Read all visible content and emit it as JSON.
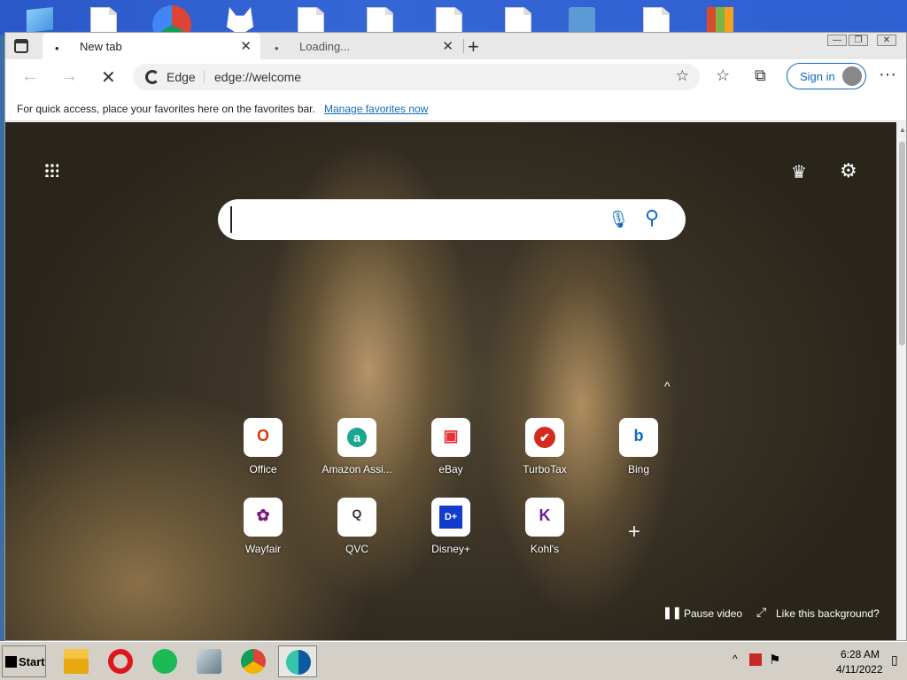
{
  "browser": {
    "tabs": [
      {
        "label": "New tab",
        "dot": "•",
        "close": "✕"
      },
      {
        "label": "Loading...",
        "dot": "•",
        "close": "✕"
      }
    ],
    "new_tab": "+",
    "window_buttons": [
      "—",
      "❐",
      "✕"
    ],
    "address": {
      "brand": "Edge",
      "url": "edge://welcome"
    },
    "sign_in_label": "Sign in",
    "more_label": "···",
    "favorites_bar": {
      "message": "For quick access, place your favorites here on the favorites bar.",
      "link": "Manage favorites now"
    }
  },
  "newtab": {
    "search": {
      "value": "",
      "placeholder": ""
    },
    "quick_links": [
      {
        "label": "Office",
        "glyph": "O",
        "color": "#d83b01"
      },
      {
        "label": "Amazon Assi...",
        "glyph": "a",
        "color": "#1aa68f"
      },
      {
        "label": "eBay",
        "glyph": "▣",
        "color": "#e53238"
      },
      {
        "label": "TurboTax",
        "glyph": "✔",
        "color": "#d52b1e"
      },
      {
        "label": "Bing",
        "glyph": "b",
        "color": "#0f6cbd"
      },
      {
        "label": "Wayfair",
        "glyph": "✿",
        "color": "#7f187f"
      },
      {
        "label": "QVC",
        "glyph": "Q",
        "color": "#333333"
      },
      {
        "label": "Disney+",
        "glyph": "D+",
        "color": "#113ccf"
      },
      {
        "label": "Kohl's",
        "glyph": "K",
        "color": "#6a1b9a"
      }
    ],
    "pause_video": "Pause video",
    "like_background": "Like this background?"
  },
  "taskbar": {
    "start_label": "Start",
    "clock": {
      "time": "6:28 AM",
      "date": "4/11/2022"
    }
  },
  "icons": {
    "back": "←",
    "forward": "→",
    "stop": "✕",
    "favorites": "☆",
    "collections": "⧉",
    "add_favorite": "☆",
    "mic": "🎙",
    "search": "⚲",
    "settings": "⚙",
    "rewards": "♛",
    "collapse": "^",
    "add_site": "+",
    "pause": "❚❚",
    "expand": "⤢",
    "tray_up": "^",
    "tray_flag": "⚑",
    "show_desktop": "▯"
  },
  "colors": {
    "accent": "#0f6cbd",
    "taskbar": "#d4d0c8"
  }
}
